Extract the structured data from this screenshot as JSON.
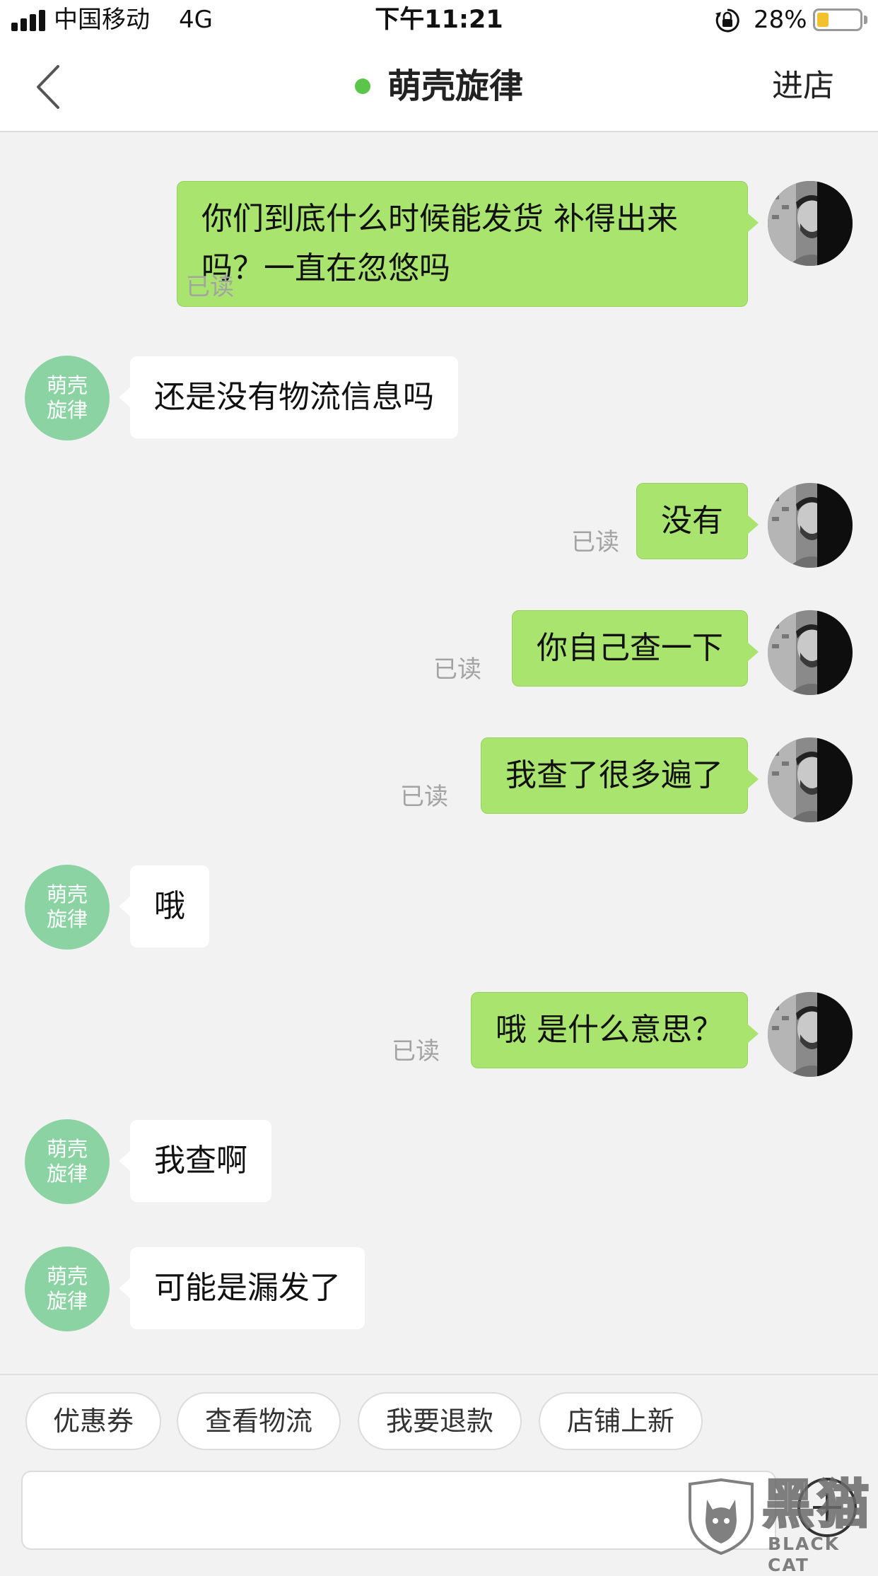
{
  "status_bar": {
    "carrier": "中国移动",
    "network": "4G",
    "time": "下午11:21",
    "battery_percent": "28%",
    "battery_level": 0.28,
    "battery_color": "#f4c12c"
  },
  "nav": {
    "back_icon": "chevron-left-icon",
    "title": "萌壳旋律",
    "online_color": "#5ac54a",
    "enter_store_label": "进店"
  },
  "shop_avatar_text": "萌壳旋律",
  "read_label": "已读",
  "messages": [
    {
      "sender": "user",
      "text": "你们到底什么时候能发货 补得出来吗？一直在忽悠吗",
      "read": true
    },
    {
      "sender": "shop",
      "text": "还是没有物流信息吗"
    },
    {
      "sender": "user",
      "text": "没有",
      "read": true
    },
    {
      "sender": "user",
      "text": "你自己查一下",
      "read": true
    },
    {
      "sender": "user",
      "text": "我查了很多遍了",
      "read": true
    },
    {
      "sender": "shop",
      "text": "哦"
    },
    {
      "sender": "user",
      "text": "哦 是什么意思？",
      "read": true
    },
    {
      "sender": "shop",
      "text": "我查啊"
    },
    {
      "sender": "shop",
      "text": "可能是漏发了"
    }
  ],
  "quick_actions": [
    "优惠券",
    "查看物流",
    "我要退款",
    "店铺上新"
  ],
  "input": {
    "value": "",
    "plus_icon": "plus-circle-icon"
  },
  "watermark": {
    "cn": "黑猫",
    "en": "BLACK CAT",
    "icon": "cat-shield-icon"
  },
  "colors": {
    "outgoing_bubble": "#a8e46e",
    "incoming_bubble": "#ffffff",
    "shop_avatar": "#8bd3a3",
    "background": "#f2f2f2"
  }
}
